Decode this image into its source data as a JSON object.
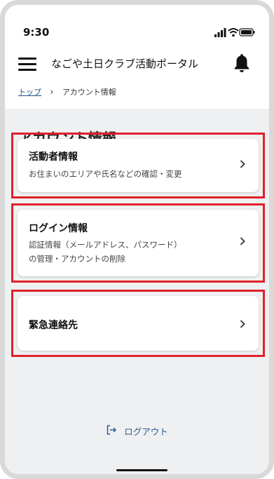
{
  "status_bar": {
    "time": "9:30"
  },
  "header": {
    "title": "なごや土日クラブ活動ポータル"
  },
  "breadcrumb": {
    "home": "トップ",
    "separator": "›",
    "current": "アカウント情報"
  },
  "page": {
    "title": "アカウント情報"
  },
  "cards": [
    {
      "title": "活動者情報",
      "desc_line1": "お住まいのエリアや氏名などの確認・変更",
      "desc_line2": ""
    },
    {
      "title": "ログイン情報",
      "desc_line1": "認証情報（メールアドレス、パスワード）",
      "desc_line2": "の管理・アカウントの削除"
    },
    {
      "title": "緊急連絡先",
      "desc_line1": "",
      "desc_line2": ""
    }
  ],
  "logout": {
    "label": "ログアウト"
  },
  "colors": {
    "highlight": "#e1202b",
    "link": "#1f4f86",
    "background": "#eef0f1"
  },
  "icons": [
    "signal-icon",
    "wifi-icon",
    "battery-icon",
    "menu-icon",
    "bell-icon",
    "chevron-right-icon",
    "logout-icon"
  ]
}
